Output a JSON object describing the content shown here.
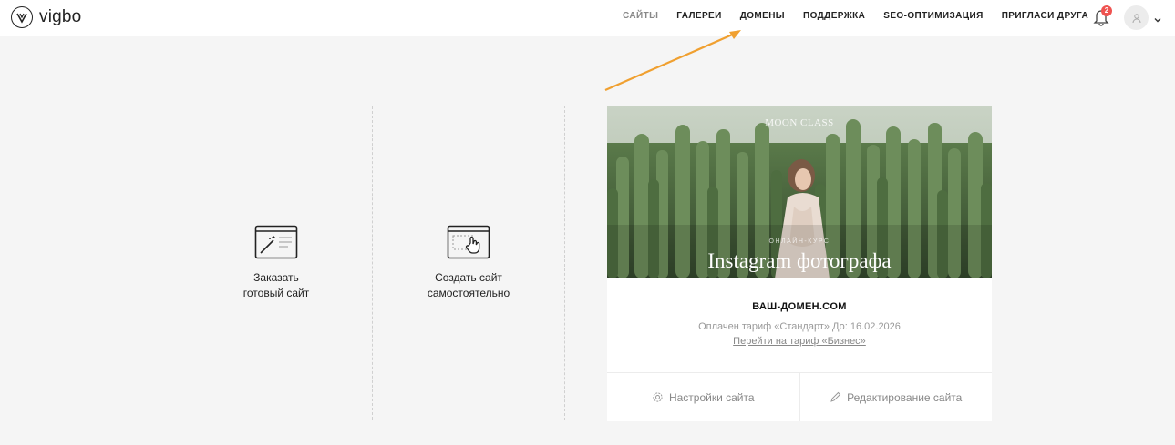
{
  "app": {
    "logo_text": "vigbo"
  },
  "nav": {
    "items": [
      {
        "label": "САЙТЫ",
        "active": false
      },
      {
        "label": "ГАЛЕРЕИ",
        "active": true
      },
      {
        "label": "ДОМЕНЫ",
        "active": true
      },
      {
        "label": "ПОДДЕРЖКА",
        "active": true
      },
      {
        "label": "SEO-ОПТИМИЗАЦИЯ",
        "active": true
      },
      {
        "label": "ПРИГЛАСИ ДРУГА",
        "active": true
      }
    ],
    "notifications_count": "2",
    "icons": [
      "bell-icon",
      "user-icon",
      "chevron-down-icon"
    ]
  },
  "annotation": {
    "arrow_color": "#f0a030"
  },
  "create": {
    "order_label": [
      "Заказать",
      "готовый сайт"
    ],
    "self_label": [
      "Создать сайт",
      "самостоятельно"
    ]
  },
  "site": {
    "preview": {
      "top_text": "MOON CLASS",
      "subtitle": "ОНЛАЙН-КУРС",
      "title": "Instagram фотографа"
    },
    "domain": "ВАШ-ДОМЕН.COM",
    "tariff": "Оплачен тариф «Стандарт» До: 16.02.2026",
    "upgrade_link": "Перейти на тариф «Бизнес»",
    "settings_label": "Настройки сайта",
    "edit_label": "Редактирование сайта"
  },
  "colors": {
    "accent_arrow": "#f0a030",
    "badge": "#ef5350",
    "background": "#f5f5f5"
  }
}
